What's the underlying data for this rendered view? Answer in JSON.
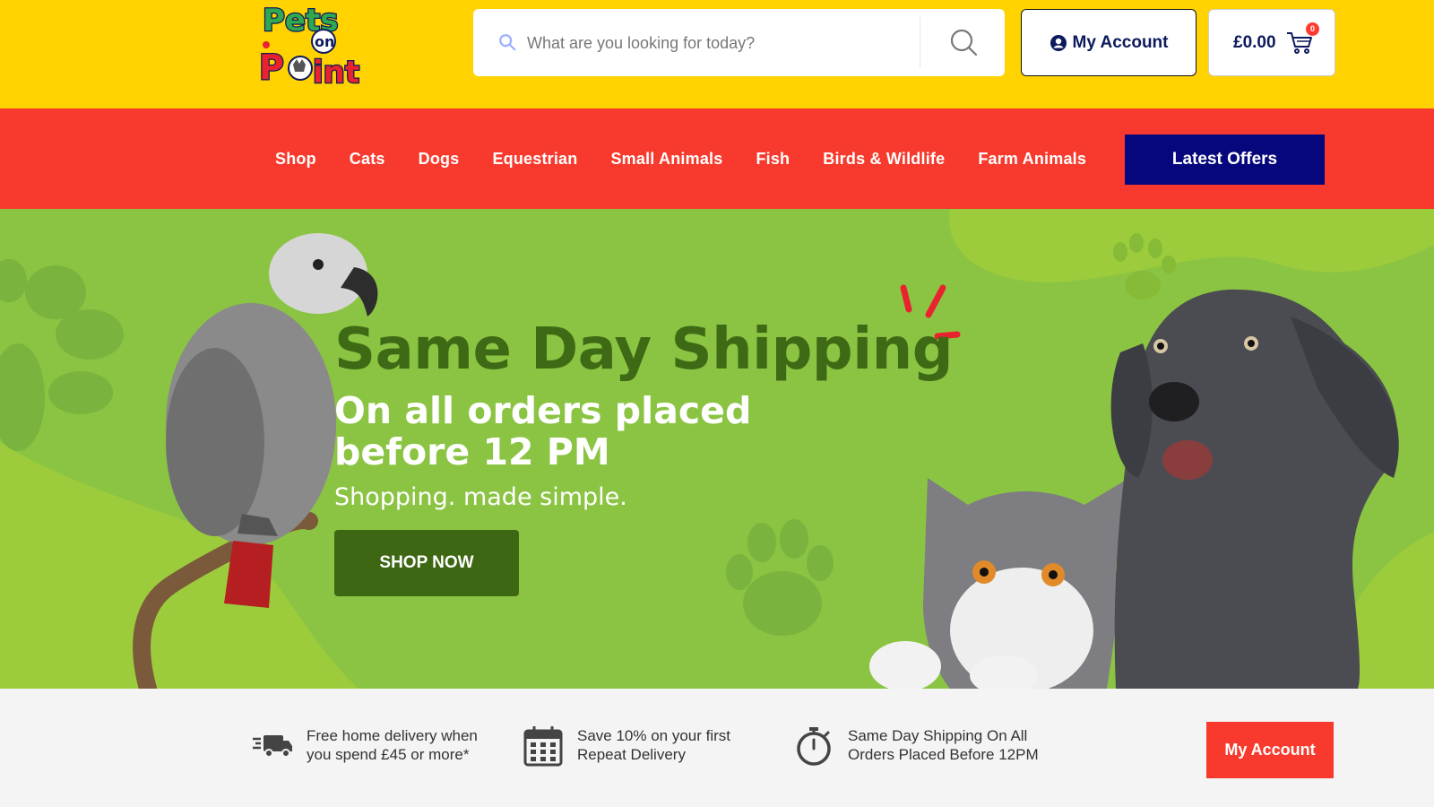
{
  "brand": {
    "logo_text": [
      "Pets",
      "on",
      "Point"
    ]
  },
  "search": {
    "placeholder": "What are you looking for today?"
  },
  "header": {
    "account_label": "My Account",
    "cart_total": "£0.00",
    "cart_count": "0"
  },
  "nav": {
    "items": [
      "Shop",
      "Cats",
      "Dogs",
      "Equestrian",
      "Small Animals",
      "Fish",
      "Birds & Wildlife",
      "Farm Animals"
    ],
    "offers_label": "Latest Offers"
  },
  "hero": {
    "title": "Same Day Shipping",
    "subtitle": "On all orders placed before 12 PM",
    "tagline": "Shopping. made simple.",
    "cta_label": "SHOP NOW"
  },
  "usp": {
    "items": [
      {
        "icon": "delivery-truck-icon",
        "text_line1": "Free home delivery when",
        "text_line2": "you spend £45 or more*"
      },
      {
        "icon": "calendar-icon",
        "text_line1": "Save 10% on your first",
        "text_line2": "Repeat Delivery"
      },
      {
        "icon": "stopwatch-icon",
        "text_line1": "Same Day Shipping On All",
        "text_line2": "Orders Placed Before 12PM"
      }
    ],
    "account_label": "My Account"
  },
  "colors": {
    "header_yellow": "#ffd200",
    "nav_red": "#f73a2d",
    "offers_navy": "#06077d",
    "hero_green": "#8bc443",
    "title_green": "#3e6a15",
    "cta_green": "#3d6713"
  }
}
